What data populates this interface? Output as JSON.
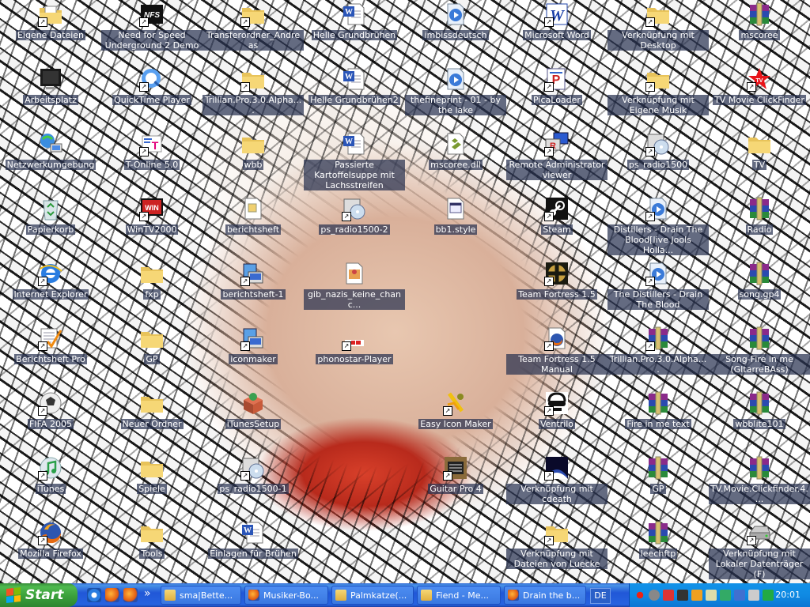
{
  "desktop_icons": [
    {
      "label": "Eigene Dateien",
      "icon": "my-documents-icon"
    },
    {
      "label": "Arbeitsplatz",
      "icon": "my-computer-icon"
    },
    {
      "label": "Netzwerkumgebung",
      "icon": "network-icon"
    },
    {
      "label": "Papierkorb",
      "icon": "recycle-bin-icon"
    },
    {
      "label": "Internet Explorer",
      "icon": "internet-explorer-icon"
    },
    {
      "label": "Berichtsheft Pro",
      "icon": "berichtsheft-icon"
    },
    {
      "label": "FIFA 2005",
      "icon": "fifa-icon"
    },
    {
      "label": "iTunes",
      "icon": "itunes-icon"
    },
    {
      "label": "Mozilla Firefox",
      "icon": "firefox-icon"
    },
    {
      "label": "Need for Speed Underground 2 Demo",
      "icon": "nfs-icon"
    },
    {
      "label": "QuickTime Player",
      "icon": "quicktime-icon"
    },
    {
      "label": "T-Online 5.0",
      "icon": "t-online-icon"
    },
    {
      "label": "WinTV2000",
      "icon": "wintv-icon"
    },
    {
      "label": "fxp",
      "icon": "folder-icon"
    },
    {
      "label": "GP",
      "icon": "folder-icon"
    },
    {
      "label": "Neuer Ordner",
      "icon": "folder-icon"
    },
    {
      "label": "Spiele",
      "icon": "folder-icon"
    },
    {
      "label": "Tools",
      "icon": "folder-icon"
    },
    {
      "label": "Transferordner_Andreas",
      "icon": "folder-icon"
    },
    {
      "label": "Trillian.Pro.3.0.Alpha....",
      "icon": "folder-icon"
    },
    {
      "label": "wbb",
      "icon": "folder-icon"
    },
    {
      "label": "berichtsheft",
      "icon": "document-icon"
    },
    {
      "label": "berichtsheft-1",
      "icon": "installer-icon"
    },
    {
      "label": "iconmaker",
      "icon": "installer-icon"
    },
    {
      "label": "iTunesSetup",
      "icon": "setup-box-icon"
    },
    {
      "label": "ps_radio1500-1",
      "icon": "setup-cd-icon"
    },
    {
      "label": "Einlagen für Brühen",
      "icon": "word-doc-icon"
    },
    {
      "label": "Helle Grundbrühen",
      "icon": "word-doc-icon"
    },
    {
      "label": "Helle Grundbrühen2",
      "icon": "word-doc-icon"
    },
    {
      "label": "Passierte Kartoffelsuppe mit Lachsstreifen",
      "icon": "word-doc-icon"
    },
    {
      "label": "ps_radio1500-2",
      "icon": "setup-cd-icon"
    },
    {
      "label": "gib_nazis_keine_chanc...",
      "icon": "image-file-icon"
    },
    {
      "label": "phonostar-Player",
      "icon": "phonostar-icon"
    },
    {
      "label": "imbissdeutsch",
      "icon": "media-file-icon"
    },
    {
      "label": "thefineprint - 01 - by the lake",
      "icon": "media-file-icon"
    },
    {
      "label": "mscoree.dll",
      "icon": "dll-icon"
    },
    {
      "label": "bb1.style",
      "icon": "style-file-icon"
    },
    {
      "label": "Easy Icon Maker",
      "icon": "easy-icon-maker-icon"
    },
    {
      "label": "Guitar Pro 4",
      "icon": "guitar-pro-icon"
    },
    {
      "label": "Microsoft Word",
      "icon": "word-app-icon"
    },
    {
      "label": "PicaLoader",
      "icon": "picaloader-icon"
    },
    {
      "label": "Remote Administrator viewer",
      "icon": "radmin-icon"
    },
    {
      "label": "Steam",
      "icon": "steam-icon"
    },
    {
      "label": "Team Fortress 1.5",
      "icon": "team-fortress-icon"
    },
    {
      "label": "Team Fortress 1.5 Manual",
      "icon": "firefox-doc-icon"
    },
    {
      "label": "Ventrilo",
      "icon": "ventrilo-icon"
    },
    {
      "label": "Verknüpfung mit cdeath",
      "icon": "cdeath-icon"
    },
    {
      "label": "Verknüpfung mit Dateien von Luecke",
      "icon": "folder-icon"
    },
    {
      "label": "Verknüpfung mit Desktop",
      "icon": "folder-icon"
    },
    {
      "label": "Verknüpfung mit Eigene Musik",
      "icon": "folder-icon"
    },
    {
      "label": "ps_radio1500",
      "icon": "setup-cd-icon"
    },
    {
      "label": "Distillers - Drain The Blood[live Jools Holla...",
      "icon": "media-file-icon"
    },
    {
      "label": "The Distillers - Drain The Blood",
      "icon": "media-file-icon"
    },
    {
      "label": "Trillian.Pro.3.0.Alpha....",
      "icon": "winrar-icon"
    },
    {
      "label": "Fire in me text",
      "icon": "winrar-icon"
    },
    {
      "label": "GP",
      "icon": "winrar-icon"
    },
    {
      "label": "leechftp",
      "icon": "winrar-icon"
    },
    {
      "label": "mscoree",
      "icon": "winrar-icon"
    },
    {
      "label": "TV Movie ClickFinder",
      "icon": "star-icon"
    },
    {
      "label": "TV",
      "icon": "folder-icon"
    },
    {
      "label": "Radio",
      "icon": "winrar-icon"
    },
    {
      "label": "song.gp4",
      "icon": "winrar-icon"
    },
    {
      "label": "Song-Fire in me (GItarreBAss)",
      "icon": "winrar-icon"
    },
    {
      "label": "wbblite101",
      "icon": "winrar-icon"
    },
    {
      "label": "TV.Movie.Clickfinder.4....",
      "icon": "winrar-icon"
    },
    {
      "label": "Verknüpfung mit Lokaler Datenträger (F)",
      "icon": "drive-icon"
    }
  ],
  "taskbar": {
    "start_label": "Start",
    "quicklaunch": [
      "internet-explorer-icon",
      "firefox-icon",
      "firefox-icon"
    ],
    "overflow": "»",
    "tasks": [
      {
        "label": "sma|Bette...",
        "icon": "folder-app-icon"
      },
      {
        "label": "Musiker-Bo...",
        "icon": "firefox-icon"
      },
      {
        "label": "Palmkatze(...",
        "icon": "folder-app-icon"
      },
      {
        "label": "Fiend - Me...",
        "icon": "folder-app-icon"
      },
      {
        "label": "Drain the b...",
        "icon": "firefox-icon"
      }
    ],
    "language": "DE",
    "clock": "20:01"
  }
}
